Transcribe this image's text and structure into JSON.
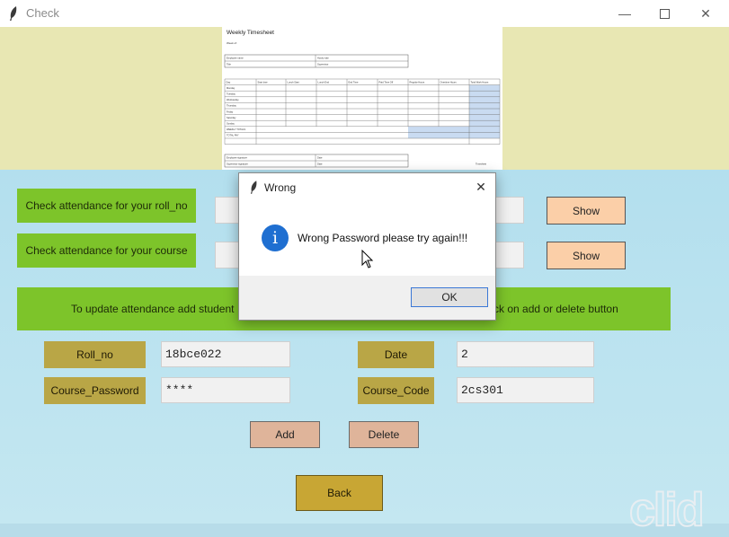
{
  "window": {
    "title": "Check"
  },
  "sheet": {
    "title": "Weekly Timesheet",
    "week_of": "Week of:",
    "info_left": [
      "Employee name",
      "Title"
    ],
    "info_right": [
      "Hourly rate",
      "Supervisor"
    ],
    "headers": [
      "Day",
      "Start time",
      "Lunch Start",
      "Lunch End",
      "End Time",
      "Paid Time Off",
      "Regular Hours",
      "Overtime Hours",
      "Total Work Hours"
    ],
    "days": [
      "Monday",
      "Tuesday",
      "Wednesday",
      "Thursday",
      "Friday",
      "Saturday",
      "Sunday"
    ],
    "weekly_totals": "WEEKLY TOTALS",
    "total_pay": "TOTAL PAY",
    "sig_left": [
      "Employee signature",
      "Supervisor signature"
    ],
    "sig_right": [
      "Date",
      "Date"
    ],
    "footer_text": "Timesheet"
  },
  "form": {
    "roll_btn": "Check attendance for your roll_no",
    "course_btn": "Check attendance for your course",
    "roll_entry": "",
    "course_entry": "",
    "roll_right_entry": "",
    "course_right_entry": "",
    "show1": "Show",
    "show2": "Show",
    "update_text_left": "To update attendance add student",
    "update_text_right": "ck on add or delete button",
    "rollno_label": "Roll_no",
    "rollno_value": "18bce022",
    "password_label": "Course_Password",
    "password_value": "****",
    "date_label": "Date",
    "date_value": "2",
    "coursecode_label": "Course_Code",
    "coursecode_value": "2cs301",
    "add": "Add",
    "delete": "Delete",
    "back": "Back"
  },
  "dialog": {
    "title": "Wrong",
    "message": "Wrong Password please try again!!!",
    "ok": "OK"
  },
  "colors": {
    "green": "#7dc42a",
    "olive": "#b9a646",
    "peach": "#fbcfa8",
    "gold": "#c8a634",
    "banner": "#e8e7b3",
    "info": "#1f6fd1"
  },
  "watermark": "clid"
}
